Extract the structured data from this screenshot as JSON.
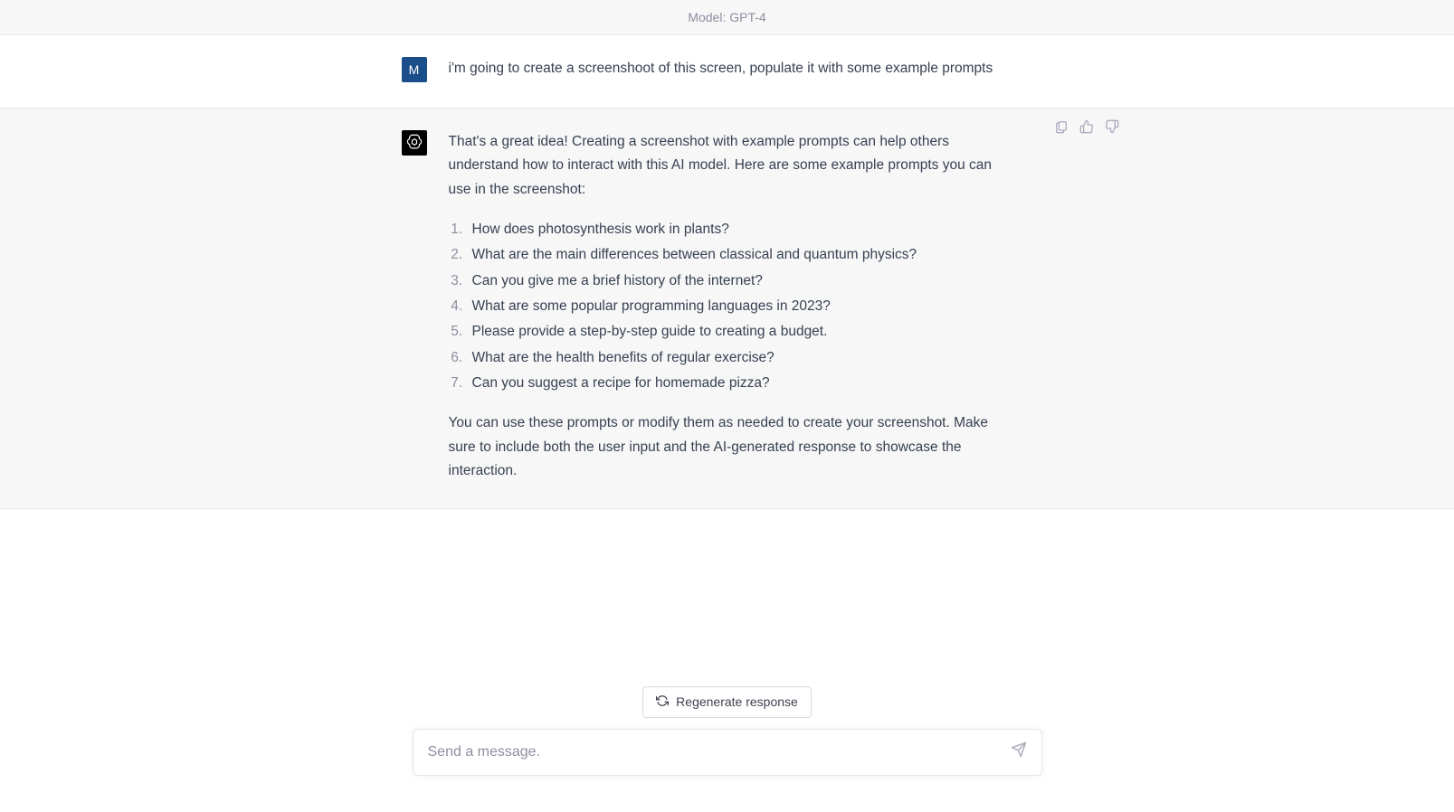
{
  "header": {
    "model_label": "Model: GPT-4"
  },
  "user_message": {
    "avatar_letter": "M",
    "text": "i'm going to create a screenshoot of this screen, populate it with some example prompts"
  },
  "assistant_message": {
    "intro": "That's a great idea! Creating a screenshot with example prompts can help others understand how to interact with this AI model. Here are some example prompts you can use in the screenshot:",
    "items": [
      "How does photosynthesis work in plants?",
      "What are the main differences between classical and quantum physics?",
      "Can you give me a brief history of the internet?",
      "What are some popular programming languages in 2023?",
      "Please provide a step-by-step guide to creating a budget.",
      "What are the health benefits of regular exercise?",
      "Can you suggest a recipe for homemade pizza?"
    ],
    "outro": "You can use these prompts or modify them as needed to create your screenshot. Make sure to include both the user input and the AI-generated response to showcase the interaction."
  },
  "controls": {
    "regenerate_label": "Regenerate response",
    "input_placeholder": "Send a message."
  }
}
